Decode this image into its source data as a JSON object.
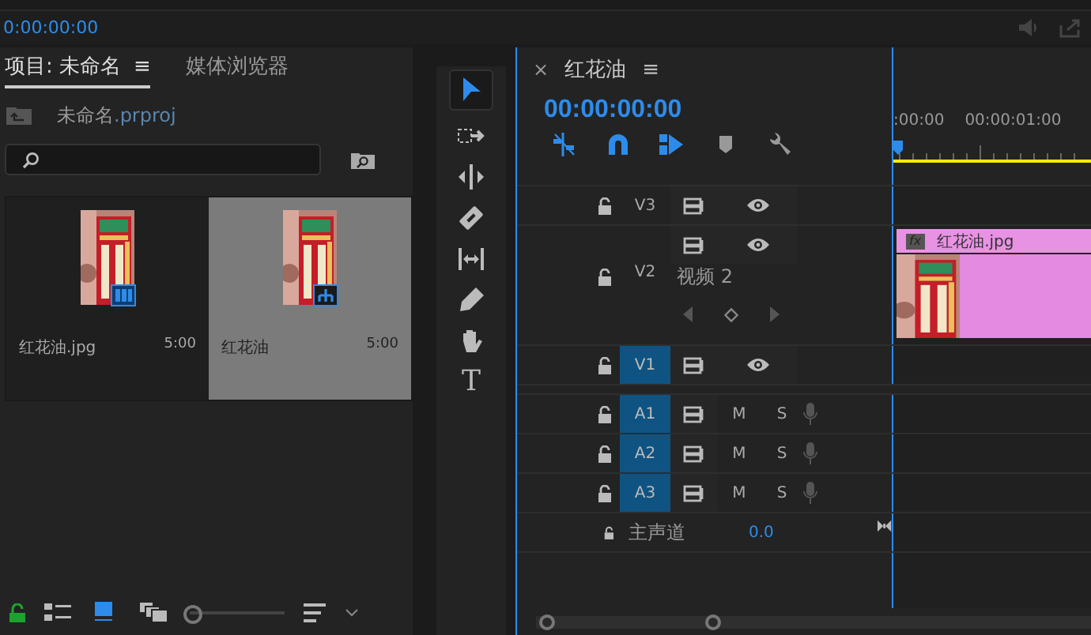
{
  "top_bar": {
    "timecode": "0:00:00:00"
  },
  "project_panel": {
    "tabs": [
      {
        "label": "项目: 未命名",
        "selected": true,
        "menu_glyph": "≡"
      },
      {
        "label": "媒体浏览器",
        "selected": false
      }
    ],
    "bin_path": {
      "name": "未命名",
      "ext": ".prproj"
    },
    "items": [
      {
        "name": "红花油.jpg",
        "duration": "5:00",
        "selected": false
      },
      {
        "name": "红花油",
        "duration": "5:00",
        "selected": true,
        "kind": "sequence"
      }
    ],
    "view_buttons": [
      {
        "kind": "list",
        "selected": false
      },
      {
        "kind": "icon",
        "selected": true
      },
      {
        "kind": "freeform",
        "selected": false
      }
    ],
    "zoom": {
      "level": 0.0
    }
  },
  "tools": [
    {
      "kind": "selection",
      "selected": true
    },
    {
      "kind": "track-select",
      "selected": false
    },
    {
      "kind": "ripple",
      "selected": false
    },
    {
      "kind": "razor",
      "selected": false
    },
    {
      "kind": "slip",
      "selected": false
    },
    {
      "kind": "pen",
      "selected": false
    },
    {
      "kind": "hand",
      "selected": false
    },
    {
      "kind": "type",
      "selected": false,
      "glyph": "T"
    }
  ],
  "timeline": {
    "close_glyph": "×",
    "title": "红花油",
    "menu_glyph": "≡",
    "timecode": "00:00:00:00",
    "toggles": [
      {
        "kind": "nest",
        "on": true
      },
      {
        "kind": "snap",
        "on": true
      },
      {
        "kind": "linked",
        "on": true
      },
      {
        "kind": "marker",
        "on": false
      },
      {
        "kind": "settings",
        "on": false
      }
    ],
    "ruler": [
      ":00:00",
      "00:00:01:00"
    ],
    "tracks": [
      {
        "kind": "video",
        "label": "V3",
        "targeted": false
      },
      {
        "kind": "video",
        "label": "V2",
        "targeted": false,
        "name": "视频 2",
        "clip": {
          "name": "红花油.jpg",
          "badge": "fx"
        }
      },
      {
        "kind": "video",
        "label": "V1",
        "targeted": true
      },
      {
        "kind": "audio",
        "label": "A1",
        "targeted": true,
        "mute": "M",
        "solo": "S"
      },
      {
        "kind": "audio",
        "label": "A2",
        "targeted": true,
        "mute": "M",
        "solo": "S"
      },
      {
        "kind": "audio",
        "label": "A3",
        "targeted": true,
        "mute": "M",
        "solo": "S"
      },
      {
        "kind": "master",
        "name": "主声道",
        "value": "0.0"
      }
    ]
  }
}
